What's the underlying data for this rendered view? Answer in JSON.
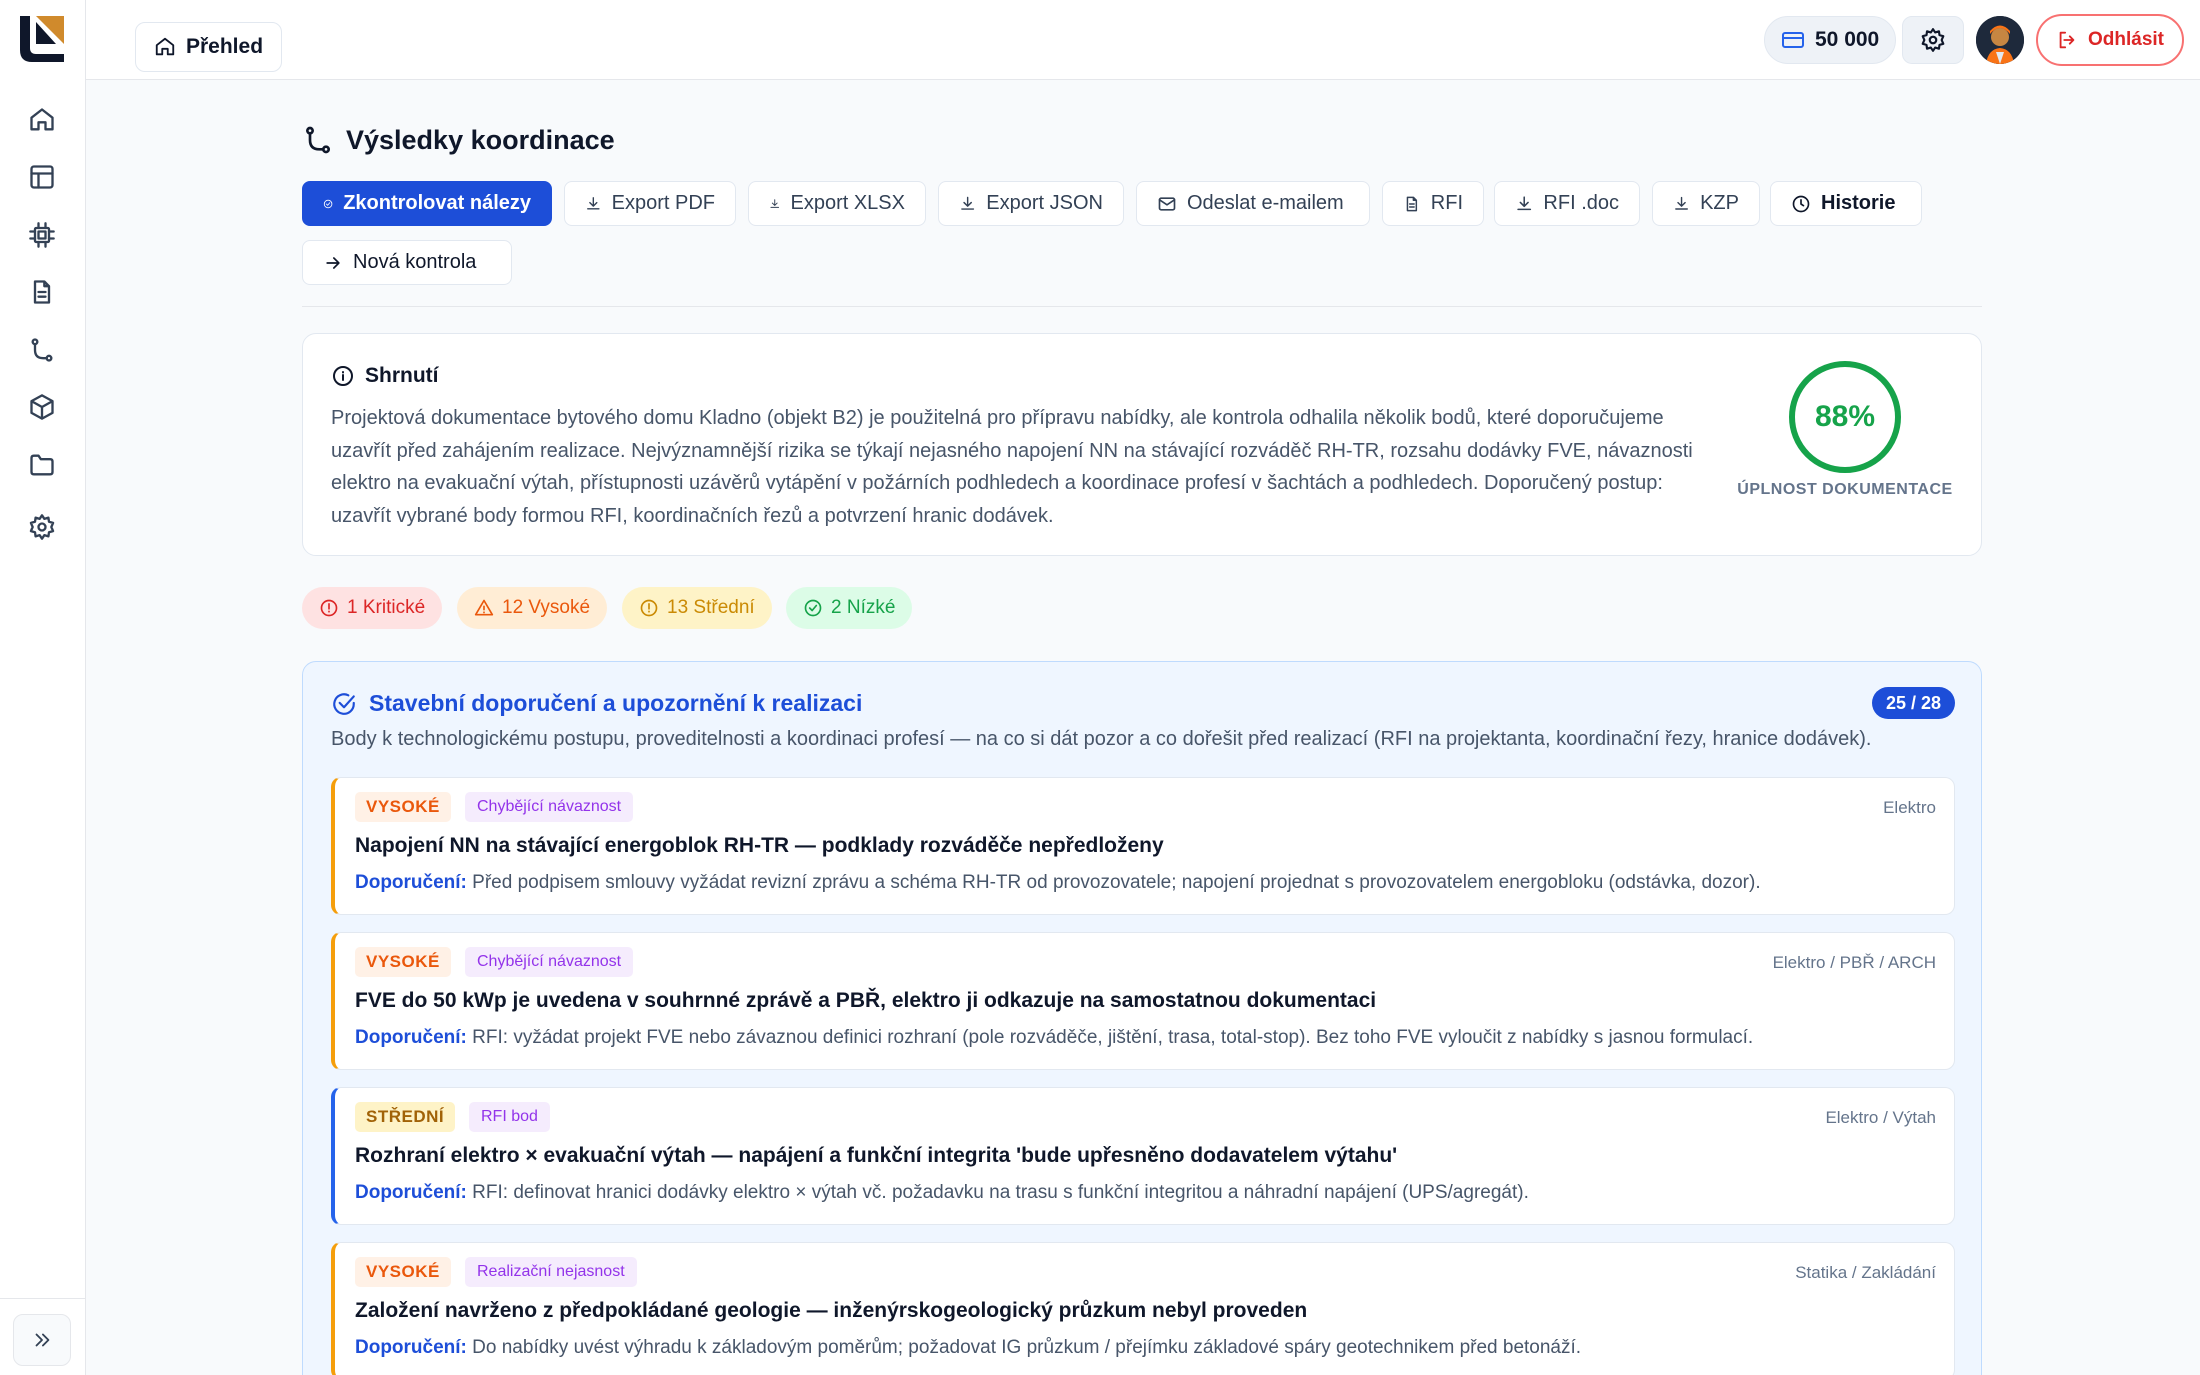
{
  "topbar": {
    "home_label": "Přehled",
    "credits": "50 000",
    "logout_label": "Odhlásit"
  },
  "page": {
    "title": "Výsledky koordinace"
  },
  "toolbar": {
    "check_findings": "Zkontrolovat nálezy",
    "export_pdf": "Export PDF",
    "export_xlsx": "Export XLSX",
    "export_json": "Export JSON",
    "send_email": "Odeslat e-mailem",
    "rfi": "RFI",
    "rfi_doc": "RFI .doc",
    "kzp": "KZP",
    "history": "Historie",
    "new_check": "Nová kontrola"
  },
  "summary": {
    "title": "Shrnutí",
    "text": "Projektová dokumentace bytového domu Kladno (objekt B2) je použitelná pro přípravu nabídky, ale kontrola odhalila několik bodů, které doporučujeme uzavřít před zahájením realizace. Nejvýznamnější rizika se týkají nejasného napojení NN na stávající rozváděč RH-TR, rozsahu dodávky FVE, návaznosti elektro na evakuační výtah, přístupnosti uzávěrů vytápění v požárních podhledech a koordinace profesí v šachtách a podhledech. Doporučený postup: uzavřít vybrané body formou RFI, koordinačních řezů a potvrzení hranic dodávek.",
    "completeness_value": "88%",
    "completeness_percent": 88,
    "completeness_label": "ÚPLNOST DOKUMENTACE"
  },
  "severity_counts": {
    "critical": "1 Kritické",
    "high": "12 Vysoké",
    "medium": "13 Střední",
    "low": "2 Nízké"
  },
  "panel": {
    "title": "Stavební doporučení a upozornění k realizaci",
    "count": "25 / 28",
    "description": "Body k technologickému postupu, proveditelnosti a koordinaci profesí — na co si dát pozor a co dořešit před realizací (RFI na projektanta, koordinační řezy, hranice dodávek).",
    "recommendation_label": "Doporučení:",
    "items": [
      {
        "severity": "VYSOKÉ",
        "category": "Chybějící návaznost",
        "discipline": "Elektro",
        "title": "Napojení NN na stávající energoblok RH-TR — podklady rozváděče nepředloženy",
        "recommendation": "Před podpisem smlouvy vyžádat revizní zprávu a schéma RH-TR od provozovatele; napojení projednat s provozovatelem energobloku (odstávka, dozor)."
      },
      {
        "severity": "VYSOKÉ",
        "category": "Chybějící návaznost",
        "discipline": "Elektro / PBŘ / ARCH",
        "title": "FVE do 50 kWp je uvedena v souhrnné zprávě a PBŘ, elektro ji odkazuje na samostatnou dokumentaci",
        "recommendation": "RFI: vyžádat projekt FVE nebo závaznou definici rozhraní (pole rozváděče, jištění, trasa, total-stop). Bez toho FVE vyloučit z nabídky s jasnou formulací."
      },
      {
        "severity": "STŘEDNÍ",
        "category": "RFI bod",
        "discipline": "Elektro / Výtah",
        "title": "Rozhraní elektro × evakuační výtah — napájení a funkční integrita 'bude upřesněno dodavatelem výtahu'",
        "recommendation": "RFI: definovat hranici dodávky elektro × výtah vč. požadavku na trasu s funkční integritou a náhradní napájení (UPS/agregát)."
      },
      {
        "severity": "VYSOKÉ",
        "category": "Realizační nejasnost",
        "discipline": "Statika / Zakládání",
        "title": "Založení navrženo z předpokládané geologie — inženýrskogeologický průzkum nebyl proveden",
        "recommendation": "Do nabídky uvést výhradu k základovým poměrům; požadovat IG průzkum / přejímku základové spáry geotechnikem před betonáží."
      }
    ]
  }
}
